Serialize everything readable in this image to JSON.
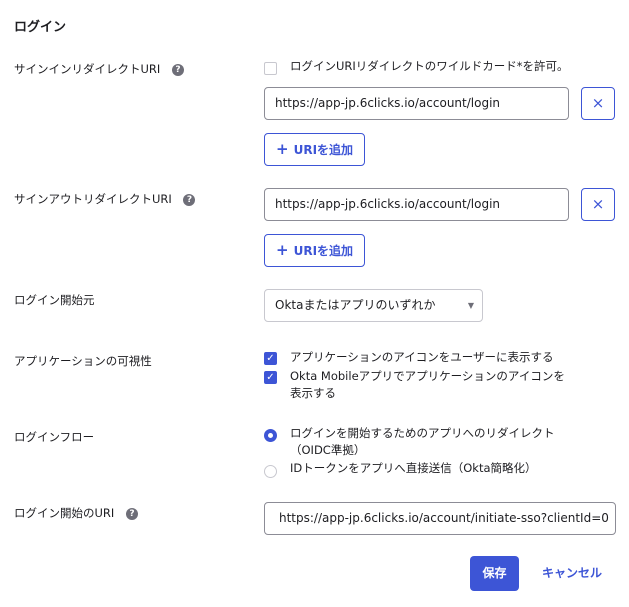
{
  "section": {
    "title": "ログイン"
  },
  "signin_redirect": {
    "label": "サインインリダイレクトURI",
    "help_icon": "?",
    "wildcard_label": "ログインURIリダイレクトのワイルドカード*を許可。",
    "wildcard_checked": false,
    "uri_value": "https://app-jp.6clicks.io/account/login",
    "remove_icon": "×",
    "add_icon": "+",
    "add_label": "URIを追加"
  },
  "signout_redirect": {
    "label": "サインアウトリダイレクトURI",
    "help_icon": "?",
    "uri_value": "https://app-jp.6clicks.io/account/login",
    "remove_icon": "×",
    "add_icon": "+",
    "add_label": "URIを追加"
  },
  "login_initiated_by": {
    "label": "ログイン開始元",
    "selected": "Oktaまたはアプリのいずれか",
    "caret_icon": "▼"
  },
  "app_visibility": {
    "label": "アプリケーションの可視性",
    "options": [
      {
        "label": "アプリケーションのアイコンをユーザーに表示する",
        "checked": true
      },
      {
        "label_line1": "Okta Mobileアプリでアプリケーションのアイコンを",
        "label_line2": "表示する",
        "checked": true
      }
    ],
    "check_glyph": "✓"
  },
  "login_flow": {
    "label": "ログインフロー",
    "options": [
      {
        "label_line1": "ログインを開始するためのアプリへのリダイレクト",
        "label_line2": "（OIDC準拠）",
        "selected": true
      },
      {
        "label": "IDトークンをアプリへ直接送信（Okta簡略化）",
        "selected": false
      }
    ]
  },
  "initiate_login_uri": {
    "label": "ログイン開始のURI",
    "help_icon": "?",
    "value": "https://app-jp.6clicks.io/account/initiate-sso?clientId=0"
  },
  "actions": {
    "save_label": "保存",
    "cancel_label": "キャンセル"
  },
  "colors": {
    "accent": "#3d55d6",
    "text": "#1d1d21",
    "help_icon_bg": "#6e6e78"
  }
}
